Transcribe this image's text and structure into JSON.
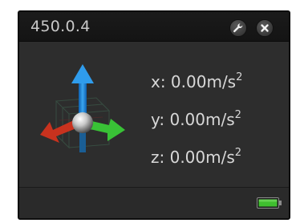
{
  "window": {
    "title": "450.0.4"
  },
  "toolbar": {
    "settings_icon": "wrench-icon",
    "close_icon": "close-icon"
  },
  "sensor": {
    "icon": "3d-axes-icon",
    "x_label": "x: 0.00m/s",
    "y_label": "y: 0.00m/s",
    "z_label": "z: 0.00m/s",
    "unit_exponent": "2"
  },
  "status": {
    "battery_icon": "battery-icon",
    "battery_color": "#3fbf2f"
  },
  "colors": {
    "panel_bg": "#2d2d2d",
    "titlebar_bg": "#181818",
    "text": "#d8d8d8",
    "axis_x": "#3fbf3f",
    "axis_y": "#1e8ee0",
    "axis_z": "#d0301c"
  }
}
